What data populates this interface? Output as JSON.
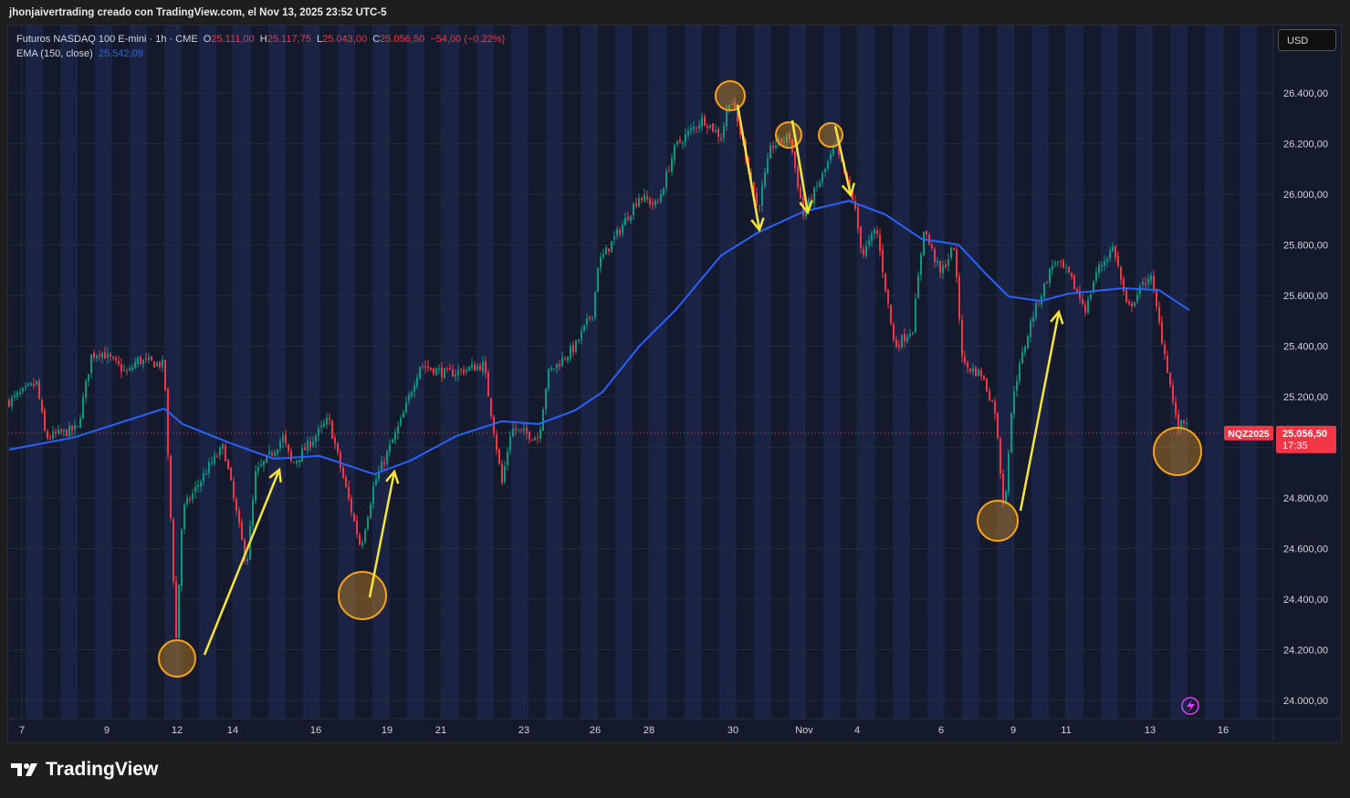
{
  "header": {
    "title": "jhonjaivertrading creado con TradingView.com, el Nov 13, 2025 23:52 UTC-5"
  },
  "legend": {
    "symbol": "Futuros NASDAQ 100 E-mini · 1h · CME",
    "o_label": "O",
    "o": "25.111,00",
    "h_label": "H",
    "h": "25.117,75",
    "l_label": "L",
    "l": "25.043,00",
    "c_label": "C",
    "c": "25.056,50",
    "change": "−54,00 (−0,22%)",
    "ema_label": "EMA (150, close)",
    "ema": "25.542,09"
  },
  "currency_button": "USD",
  "price_tag": {
    "symbol": "NQZ2025",
    "price": "25.056,50",
    "countdown": "17:35"
  },
  "brand": "TradingView",
  "colors": {
    "up": "#089981",
    "down": "#f23645",
    "ema": "#2962ff",
    "annotation": "#f7e53b",
    "circle": "#f7a21b"
  },
  "chart_data": {
    "type": "candlestick",
    "title": "Futuros NASDAQ 100 E-mini · 1h · CME",
    "ylim": [
      23950,
      26550
    ],
    "y_ticks": [
      "26.400,00",
      "26.200,00",
      "26.000,00",
      "25.800,00",
      "25.600,00",
      "25.400,00",
      "25.200,00",
      "25.000,00",
      "24.800,00",
      "24.600,00",
      "24.400,00",
      "24.200,00",
      "24.000,00"
    ],
    "y_tick_values": [
      26400,
      26200,
      26000,
      25800,
      25600,
      25400,
      25200,
      25000,
      24800,
      24600,
      24400,
      24200,
      24000
    ],
    "x_ticks": [
      "7",
      "9",
      "12",
      "14",
      "16",
      "19",
      "21",
      "23",
      "26",
      "28",
      "30",
      "Nov",
      "4",
      "6",
      "9",
      "11",
      "13",
      "16"
    ],
    "x_tick_t": [
      1.4,
      10.7,
      18.4,
      24.5,
      33.6,
      41.4,
      47.3,
      56.4,
      64.2,
      70.1,
      79.3,
      87.1,
      92.9,
      102.1,
      110,
      115.8,
      125,
      133
    ],
    "price_path": [
      [
        0,
        25182
      ],
      [
        3,
        25254
      ],
      [
        4,
        25038
      ],
      [
        7.5,
        25074
      ],
      [
        9,
        25362
      ],
      [
        10,
        25380
      ],
      [
        13,
        25290
      ],
      [
        14,
        25344
      ],
      [
        17,
        25326
      ],
      [
        17.3,
        25038
      ],
      [
        18.3,
        24245
      ],
      [
        19,
        24750
      ],
      [
        22,
        24930
      ],
      [
        23.5,
        25002
      ],
      [
        26,
        24533
      ],
      [
        27,
        24894
      ],
      [
        30,
        25038
      ],
      [
        31,
        24930
      ],
      [
        35,
        25110
      ],
      [
        36.5,
        24894
      ],
      [
        38.5,
        24605
      ],
      [
        40,
        24858
      ],
      [
        43,
        25110
      ],
      [
        45,
        25326
      ],
      [
        48,
        25290
      ],
      [
        52,
        25326
      ],
      [
        54,
        24858
      ],
      [
        55,
        25074
      ],
      [
        58,
        25038
      ],
      [
        59,
        25290
      ],
      [
        62,
        25398
      ],
      [
        64,
        25542
      ],
      [
        64.5,
        25722
      ],
      [
        67,
        25866
      ],
      [
        69,
        25992
      ],
      [
        71,
        25956
      ],
      [
        73,
        26190
      ],
      [
        76,
        26299
      ],
      [
        78,
        26227
      ],
      [
        79,
        26389
      ],
      [
        80.5,
        26190
      ],
      [
        82,
        25938
      ],
      [
        83.5,
        26190
      ],
      [
        85.5,
        26227
      ],
      [
        87,
        25920
      ],
      [
        89,
        26064
      ],
      [
        90.5,
        26190
      ],
      [
        92.5,
        25974
      ],
      [
        93.5,
        25758
      ],
      [
        95,
        25866
      ],
      [
        97,
        25398
      ],
      [
        99,
        25470
      ],
      [
        100.2,
        25866
      ],
      [
        102,
        25686
      ],
      [
        103.5,
        25794
      ],
      [
        104.5,
        25326
      ],
      [
        106.5,
        25290
      ],
      [
        108,
        25146
      ],
      [
        109,
        24750
      ],
      [
        110,
        25218
      ],
      [
        112,
        25506
      ],
      [
        114.5,
        25740
      ],
      [
        116,
        25686
      ],
      [
        118,
        25542
      ],
      [
        119,
        25686
      ],
      [
        121,
        25794
      ],
      [
        122.5,
        25542
      ],
      [
        125,
        25686
      ],
      [
        127,
        25290
      ],
      [
        128,
        25074
      ],
      [
        129,
        25110
      ]
    ],
    "ema_150": [
      [
        0,
        24991
      ],
      [
        7,
        25038
      ],
      [
        17,
        25153
      ],
      [
        19,
        25092
      ],
      [
        24,
        25020
      ],
      [
        29,
        24955
      ],
      [
        34,
        24966
      ],
      [
        40,
        24894
      ],
      [
        44,
        24948
      ],
      [
        49,
        25045
      ],
      [
        54,
        25103
      ],
      [
        58,
        25092
      ],
      [
        62,
        25146
      ],
      [
        65,
        25218
      ],
      [
        69,
        25398
      ],
      [
        73,
        25542
      ],
      [
        78,
        25758
      ],
      [
        82,
        25848
      ],
      [
        87,
        25931
      ],
      [
        92,
        25974
      ],
      [
        96,
        25920
      ],
      [
        100,
        25823
      ],
      [
        104,
        25801
      ],
      [
        107,
        25686
      ],
      [
        109.5,
        25596
      ],
      [
        113,
        25578
      ],
      [
        116,
        25607
      ],
      [
        122,
        25629
      ],
      [
        126,
        25621
      ],
      [
        129.3,
        25542
      ]
    ],
    "last_price": 25056.5
  }
}
